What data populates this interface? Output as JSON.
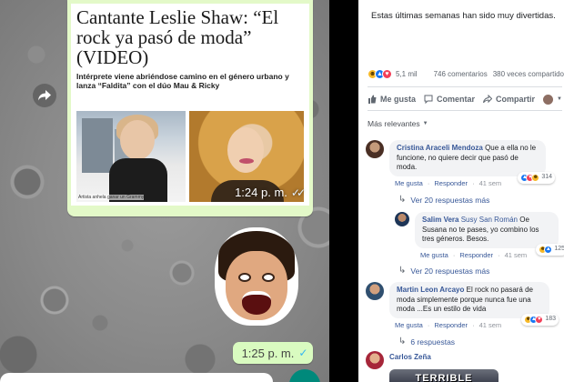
{
  "chat": {
    "article": {
      "headline": "Cantante Leslie Shaw: “El rock ya pasó de moda” (VIDEO)",
      "subheadline": "Intérprete viene abriéndose camino en el género urbano y lanza “Faldita” con el dúo Mau & Ricky",
      "photo_caption": "Artista anhela ganar un Grammy",
      "time": "1:24 p. m."
    },
    "reply": {
      "time": "1:25 p. m."
    },
    "icons": {
      "share": "share-arrow-icon",
      "read_receipt": "double-check-icon"
    }
  },
  "fb": {
    "post_text": "Estas últimas semanas han sido muy divertidas.",
    "stats": {
      "reactions": "5,1 mil",
      "comments": "746 comentarios",
      "shares": "380 veces compartido"
    },
    "actions": {
      "like": "Me gusta",
      "comment": "Comentar",
      "share": "Compartir"
    },
    "sort_label": "Más relevantes",
    "comments": [
      {
        "name": "Cristina Araceli Mendoza",
        "text": "Que a ella no le funcione, no quiere decir que pasó de moda.",
        "like": "Me gusta",
        "reply": "Responder",
        "age": "41 sem",
        "reaction_count": "314",
        "replies_label": "Ver 20 respuestas más"
      },
      {
        "name": "Salim Vera",
        "mention": "Susy San Román",
        "text": "Oe Susana no te pases, yo combino los tres géneros. Besos.",
        "like": "Me gusta",
        "reply": "Responder",
        "age": "41 sem",
        "reaction_count": "125",
        "replies_label": "Ver 20 respuestas más"
      },
      {
        "name": "Martin Leon Arcayo",
        "text": "El rock no pasará de moda simplemente porque nunca fue una moda ...Es un estilo de vida",
        "like": "Me gusta",
        "reply": "Responder",
        "age": "41 sem",
        "reaction_count": "183",
        "replies_label": "6 respuestas"
      },
      {
        "name": "Carlos Zeña",
        "gif_text": "TERRIBLE"
      }
    ],
    "colors": {
      "link": "#385898",
      "like_blue": "#1877f2",
      "love_red": "#f33e58",
      "haha_yellow": "#f7b928"
    }
  }
}
